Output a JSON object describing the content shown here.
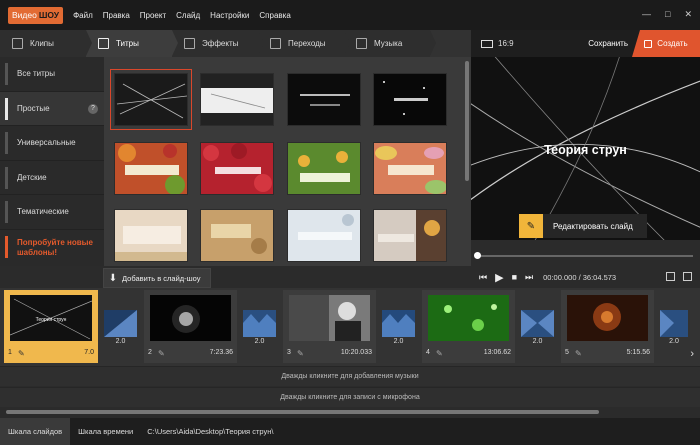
{
  "app": {
    "logo_left": "Видео",
    "logo_right": "ШОУ"
  },
  "menu": [
    "Файл",
    "Правка",
    "Проект",
    "Слайд",
    "Настройки",
    "Справка"
  ],
  "window_controls": [
    "—",
    "□",
    "✕"
  ],
  "tabs": [
    {
      "label": "Клипы",
      "icon": "film-icon"
    },
    {
      "label": "Титры",
      "icon": "text-icon"
    },
    {
      "label": "Эффекты",
      "icon": "wand-icon"
    },
    {
      "label": "Переходы",
      "icon": "transition-icon"
    },
    {
      "label": "Музыка",
      "icon": "music-icon"
    }
  ],
  "sidebar": {
    "items": [
      {
        "label": "Все титры"
      },
      {
        "label": "Простые"
      },
      {
        "label": "Универсальные"
      },
      {
        "label": "Детские"
      },
      {
        "label": "Тематические"
      }
    ],
    "help": "?",
    "promo": "Попробуйте новые шаблоны!"
  },
  "thumbnails": [
    {
      "text": "Бесконечная теория"
    },
    {
      "text": "Бесконечная..."
    },
    {
      "text": "ОЧЕНЬ ВАЖНЫЙ СЛАЙД"
    },
    {
      "text": "Тема для..."
    },
    {
      "text": "Добавить свой..."
    },
    {
      "text": "Весенний праздник..."
    },
    {
      "text": "Добро пожаловать..."
    },
    {
      "text": "Праздничные сладости"
    },
    {
      "text": "Праздничные..."
    },
    {
      "text": "Новое поколение..."
    },
    {
      "text": "Весенний свет..."
    },
    {
      "text": "Бесконечная теория..."
    }
  ],
  "preview": {
    "ratio": "16:9",
    "save": "Сохранить",
    "create": "Создать",
    "title": "Теория струн",
    "edit": "Редактировать слайд",
    "timecode": "00:00.000 / 36:04.573"
  },
  "addbar": {
    "label": "Добавить в слайд-шоу"
  },
  "timeline": {
    "slides": [
      {
        "num": "1",
        "dur": "7.0",
        "caption": "Теория струн"
      },
      {
        "num": "2",
        "dur": "7:23.36"
      },
      {
        "num": "3",
        "dur": "10:20.033"
      },
      {
        "num": "4",
        "dur": "13:06.62"
      },
      {
        "num": "5",
        "dur": "5:15.56"
      }
    ],
    "transitions": [
      "2.0",
      "2.0",
      "2.0",
      "2.0",
      "2.0"
    ],
    "music_hint": "Дважды кликните для добавления музыки",
    "mic_hint": "Дважды кликните для записи с микрофона"
  },
  "bottom": {
    "tab_slides": "Шкала слайдов",
    "tab_time": "Шкала времени",
    "path": "C:\\Users\\Aida\\Desktop\\Теория струн\\"
  },
  "colors": {
    "accent": "#e0552e",
    "highlight": "#f0b84d",
    "promo": "#e45a2c"
  }
}
